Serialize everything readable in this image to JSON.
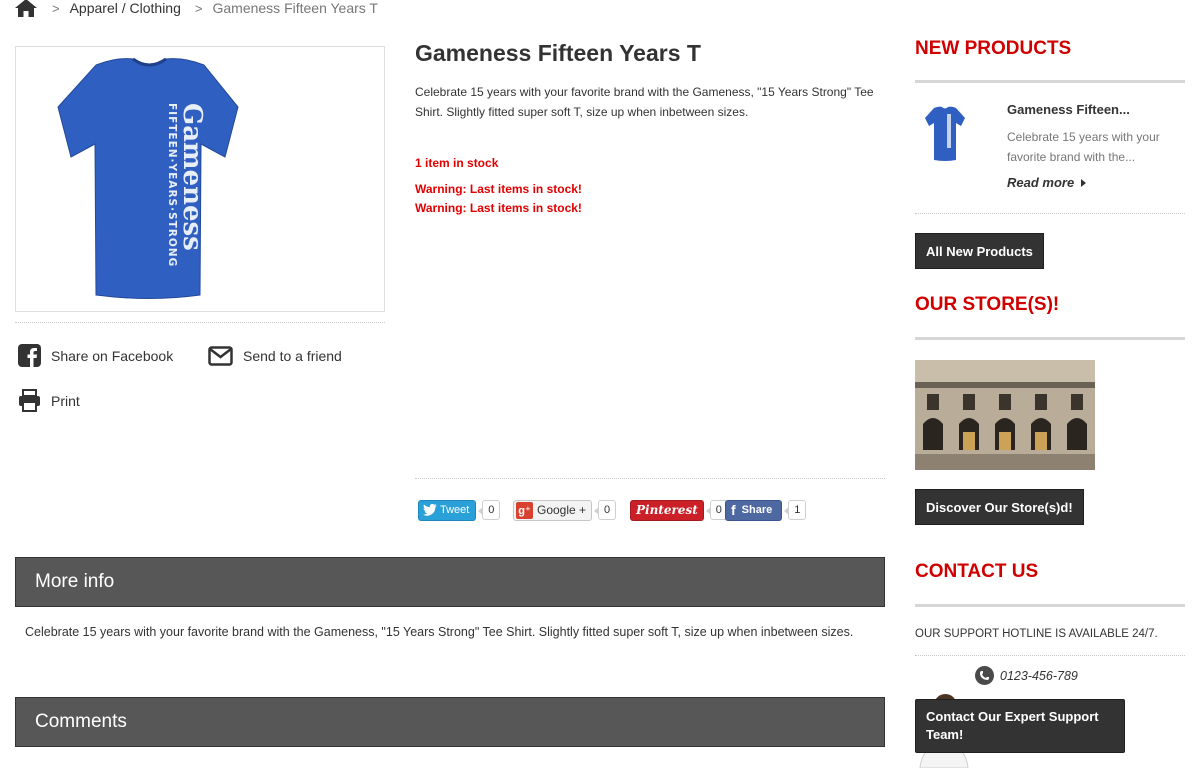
{
  "breadcrumb": {
    "home_icon": "home-icon",
    "separator": ">",
    "category": "Apparel / Clothing",
    "current": "Gameness Fifteen Years T"
  },
  "product": {
    "title": "Gameness Fifteen Years T",
    "description": "Celebrate 15 years with your favorite brand with the Gameness, \"15 Years Strong\" Tee Shirt.  Slightly fitted super soft T, size up when inbetween sizes.",
    "stock": "1 item in stock",
    "warnings": [
      "Warning: Last items in stock!",
      "Warning: Last items in stock!"
    ],
    "shirt_text": "Gameness",
    "shirt_subtext": "FIFTEEN·YEARS·STRONG",
    "shirt_color": "#2f5fc0"
  },
  "actions": {
    "facebook": "Share on Facebook",
    "send_friend": "Send to a friend",
    "print": "Print"
  },
  "social": {
    "tweet": {
      "label": "Tweet",
      "count": "0"
    },
    "google": {
      "label": "Google +",
      "count": "0"
    },
    "pinterest": {
      "label": "Pinterest",
      "count": "0"
    },
    "facebook": {
      "label": "Share",
      "count": "1"
    }
  },
  "sections": {
    "more_info": "More info",
    "more_info_text": "Celebrate 15 years with your favorite brand with the Gameness, \"15 Years Strong\" Tee Shirt.  Slightly fitted super soft T, size up when inbetween sizes.",
    "comments": "Comments"
  },
  "sidebar": {
    "new_products": {
      "title": "NEW PRODUCTS",
      "item_title": "Gameness Fifteen...",
      "item_desc": "Celebrate 15 years with your favorite brand with the...",
      "read_more": "Read more",
      "button": "All New Products"
    },
    "stores": {
      "title": "OUR STORE(S)!",
      "button": "Discover Our Store(s)d!"
    },
    "contact": {
      "title": "CONTACT US",
      "hotline": "OUR SUPPORT HOTLINE IS AVAILABLE 24/7.",
      "phone": "0123-456-789",
      "button": "Contact Our Expert Support Team!"
    }
  },
  "colors": {
    "accent_red": "#d00000",
    "warning_red": "#e30000",
    "section_bar": "#575757",
    "button_dark": "#333333"
  }
}
